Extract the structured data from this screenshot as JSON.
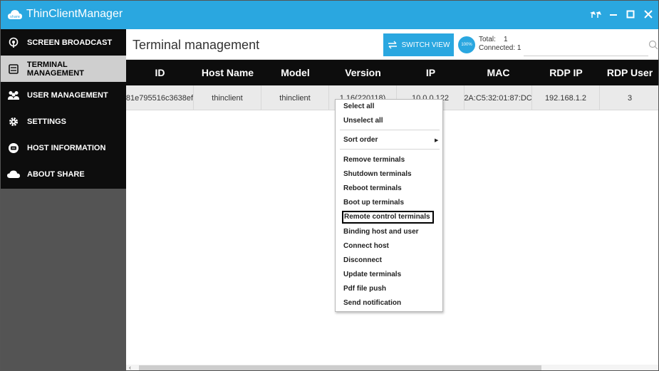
{
  "window": {
    "title": "ThinClientManager",
    "logo_text": "share",
    "controls": [
      "pin-icon",
      "minimize-icon",
      "maximize-icon",
      "close-icon"
    ]
  },
  "colors": {
    "accent": "#2aa7e0",
    "sidebar_bg": "#0d0d0d",
    "sidebar_lower": "#545454",
    "active_item": "#cfcfcf",
    "header_bg": "#0d0d0d",
    "row_bg": "#eaeaea"
  },
  "sidebar": {
    "items": [
      {
        "label": "SCREEN BROADCAST",
        "icon": "broadcast-icon",
        "active": false
      },
      {
        "label": "TERMINAL MANAGEMENT",
        "icon": "terminal-icon",
        "active": true
      },
      {
        "label": "USER MANAGEMENT",
        "icon": "users-icon",
        "active": false
      },
      {
        "label": "SETTINGS",
        "icon": "gear-icon",
        "active": false
      },
      {
        "label": "HOST INFORMATION",
        "icon": "host-icon",
        "active": false
      },
      {
        "label": "ABOUT SHARE",
        "icon": "cloud-icon",
        "active": false
      }
    ]
  },
  "main": {
    "title": "Terminal management",
    "switch_view_label": "SWITCH VIEW",
    "percent_badge": "100%",
    "total_label": "Total:",
    "total_value": "1",
    "connected_label": "Connected: 1",
    "search_placeholder": ""
  },
  "table": {
    "columns": [
      "ID",
      "Host Name",
      "Model",
      "Version",
      "IP",
      "MAC",
      "RDP IP",
      "RDP User"
    ],
    "rows": [
      [
        "81e795516c3638ef",
        "thinclient",
        "thinclient",
        "1.16(220118)",
        "10.0.0.122",
        "2A:C5:32:01:87:DC",
        "192.168.1.2",
        "3"
      ]
    ]
  },
  "context_menu": {
    "group1": [
      "Select all",
      "Unselect all"
    ],
    "group2": {
      "label": "Sort order",
      "has_submenu": true
    },
    "group3": [
      "Remove terminals",
      "Shutdown terminals",
      "Reboot terminals",
      "Boot up terminals",
      "Remote control terminals",
      "Binding host and user",
      "Connect host",
      "Disconnect",
      "Update terminals",
      "Pdf file push",
      "Send notification"
    ],
    "highlighted": "Remote control terminals"
  }
}
